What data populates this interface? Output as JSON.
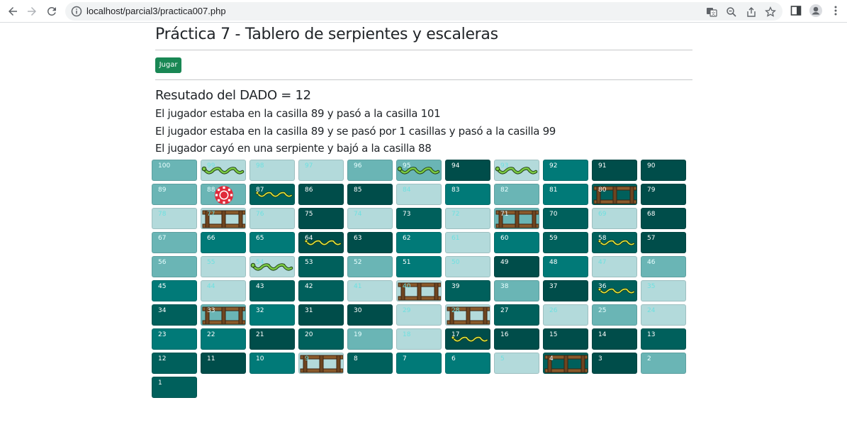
{
  "browser": {
    "url": "localhost/parcial3/practica007.php"
  },
  "page": {
    "title": "Práctica 7 - Tablero de serpientes y escaleras",
    "button_label": "Jugar",
    "dice_result": "Resutado del DADO = 12",
    "messages": [
      "El jugador estaba en la casilla 89 y pasó a la casilla 101",
      "El jugador estaba en la casilla 89 y se pasó por 1 casillas y pasó a la casilla 99",
      "El jugador cayó en una serpiente y bajó a la casilla 88"
    ]
  },
  "colors": {
    "dark": "#004d4a",
    "teal": "#017a78",
    "deep": "#00605c",
    "mid": "#6ab5b5",
    "light": "#b3dadb",
    "button": "#198754"
  },
  "board": {
    "rows": [
      [
        {
          "n": "100",
          "c": "mid"
        },
        {
          "n": "99",
          "c": "light",
          "i": "snake"
        },
        {
          "n": "98",
          "c": "light"
        },
        {
          "n": "97",
          "c": "light"
        },
        {
          "n": "96",
          "c": "mid"
        },
        {
          "n": "95",
          "c": "mid",
          "i": "snake"
        },
        {
          "n": "94",
          "c": "dark"
        },
        {
          "n": "93",
          "c": "light",
          "i": "snake"
        },
        {
          "n": "92",
          "c": "teal"
        },
        {
          "n": "91",
          "c": "dark"
        },
        {
          "n": "90",
          "c": "dark"
        }
      ],
      [
        {
          "n": "89",
          "c": "mid"
        },
        {
          "n": "88",
          "c": "mid",
          "i": "chip"
        },
        {
          "n": "87",
          "c": "deep",
          "i": "snake-small"
        },
        {
          "n": "86",
          "c": "dark"
        },
        {
          "n": "85",
          "c": "dark"
        },
        {
          "n": "84",
          "c": "light"
        },
        {
          "n": "83",
          "c": "teal"
        },
        {
          "n": "82",
          "c": "mid"
        },
        {
          "n": "81",
          "c": "teal"
        },
        {
          "n": "80",
          "c": "deep",
          "i": "ladder"
        },
        {
          "n": "79",
          "c": "dark"
        }
      ],
      [
        {
          "n": "78",
          "c": "light"
        },
        {
          "n": "77",
          "c": "light",
          "i": "ladder"
        },
        {
          "n": "76",
          "c": "light"
        },
        {
          "n": "75",
          "c": "dark"
        },
        {
          "n": "74",
          "c": "light"
        },
        {
          "n": "73",
          "c": "deep"
        },
        {
          "n": "72",
          "c": "light"
        },
        {
          "n": "71",
          "c": "mid",
          "i": "ladder"
        },
        {
          "n": "70",
          "c": "deep"
        },
        {
          "n": "69",
          "c": "light"
        },
        {
          "n": "68",
          "c": "dark"
        }
      ],
      [
        {
          "n": "67",
          "c": "mid"
        },
        {
          "n": "66",
          "c": "teal"
        },
        {
          "n": "65",
          "c": "teal"
        },
        {
          "n": "64",
          "c": "dark",
          "i": "snake-small"
        },
        {
          "n": "63",
          "c": "dark"
        },
        {
          "n": "62",
          "c": "teal"
        },
        {
          "n": "61",
          "c": "light"
        },
        {
          "n": "60",
          "c": "teal"
        },
        {
          "n": "59",
          "c": "deep"
        },
        {
          "n": "58",
          "c": "deep",
          "i": "snake-small"
        },
        {
          "n": "57",
          "c": "dark"
        }
      ],
      [
        {
          "n": "56",
          "c": "mid"
        },
        {
          "n": "55",
          "c": "light"
        },
        {
          "n": "54",
          "c": "light",
          "i": "snake"
        },
        {
          "n": "53",
          "c": "deep"
        },
        {
          "n": "52",
          "c": "mid"
        },
        {
          "n": "51",
          "c": "teal"
        },
        {
          "n": "50",
          "c": "light"
        },
        {
          "n": "49",
          "c": "dark"
        },
        {
          "n": "48",
          "c": "teal"
        },
        {
          "n": "47",
          "c": "light"
        },
        {
          "n": "46",
          "c": "mid"
        }
      ],
      [
        {
          "n": "45",
          "c": "teal"
        },
        {
          "n": "44",
          "c": "light"
        },
        {
          "n": "43",
          "c": "deep"
        },
        {
          "n": "42",
          "c": "deep"
        },
        {
          "n": "41",
          "c": "light"
        },
        {
          "n": "40",
          "c": "light",
          "i": "ladder"
        },
        {
          "n": "39",
          "c": "deep"
        },
        {
          "n": "38",
          "c": "mid"
        },
        {
          "n": "37",
          "c": "dark"
        },
        {
          "n": "36",
          "c": "deep",
          "i": "snake-small"
        },
        {
          "n": "35",
          "c": "light"
        }
      ],
      [
        {
          "n": "34",
          "c": "deep"
        },
        {
          "n": "33",
          "c": "mid",
          "i": "ladder"
        },
        {
          "n": "32",
          "c": "teal"
        },
        {
          "n": "31",
          "c": "dark"
        },
        {
          "n": "30",
          "c": "dark"
        },
        {
          "n": "29",
          "c": "light"
        },
        {
          "n": "28",
          "c": "light",
          "i": "ladder"
        },
        {
          "n": "27",
          "c": "deep"
        },
        {
          "n": "26",
          "c": "light"
        },
        {
          "n": "25",
          "c": "mid"
        },
        {
          "n": "24",
          "c": "light"
        }
      ],
      [
        {
          "n": "23",
          "c": "teal"
        },
        {
          "n": "22",
          "c": "teal"
        },
        {
          "n": "21",
          "c": "dark"
        },
        {
          "n": "20",
          "c": "deep"
        },
        {
          "n": "19",
          "c": "mid"
        },
        {
          "n": "18",
          "c": "light"
        },
        {
          "n": "17",
          "c": "dark",
          "i": "snake-small"
        },
        {
          "n": "16",
          "c": "dark"
        },
        {
          "n": "15",
          "c": "dark"
        },
        {
          "n": "14",
          "c": "dark"
        },
        {
          "n": "13",
          "c": "deep"
        }
      ],
      [
        {
          "n": "12",
          "c": "deep"
        },
        {
          "n": "11",
          "c": "dark"
        },
        {
          "n": "10",
          "c": "teal"
        },
        {
          "n": "9",
          "c": "light",
          "i": "ladder"
        },
        {
          "n": "8",
          "c": "deep"
        },
        {
          "n": "7",
          "c": "teal"
        },
        {
          "n": "6",
          "c": "teal"
        },
        {
          "n": "5",
          "c": "light"
        },
        {
          "n": "4",
          "c": "deep",
          "i": "ladder"
        },
        {
          "n": "3",
          "c": "dark"
        },
        {
          "n": "2",
          "c": "mid"
        }
      ],
      [
        {
          "n": "1",
          "c": "deep"
        }
      ]
    ]
  }
}
